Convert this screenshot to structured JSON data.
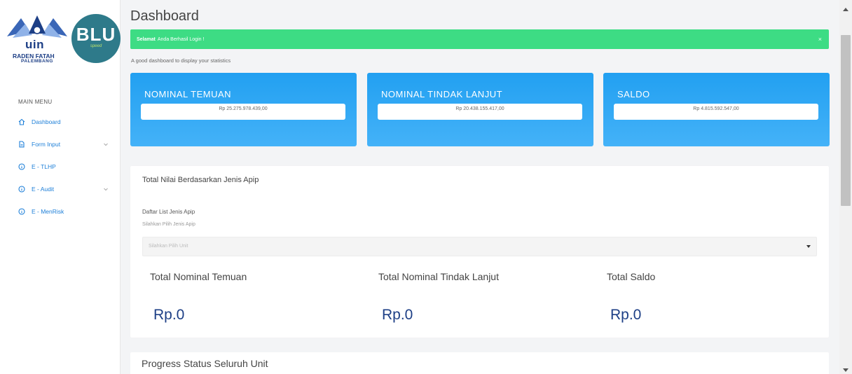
{
  "branding": {
    "uin_logo_text": "uin",
    "uin_name": "RADEN FATAH",
    "uin_city": "PALEMBANG",
    "blu_logo_text": "BLU",
    "blu_tagline": "speed"
  },
  "sidebar": {
    "section_label": "MAIN MENU",
    "items": [
      {
        "label": "Dashboard",
        "icon": "home-icon"
      },
      {
        "label": "Form Input",
        "icon": "document-icon",
        "has_submenu": true
      },
      {
        "label": "E - TLHP",
        "icon": "info-circle-icon"
      },
      {
        "label": "E - Audit",
        "icon": "info-circle-icon",
        "has_submenu": true
      },
      {
        "label": "E - MenRisk",
        "icon": "info-circle-icon"
      }
    ],
    "accent_color": "#1d7fd8"
  },
  "header": {
    "title": "Dashboard"
  },
  "alert": {
    "strong": "Selamat",
    "message": "Anda Berhasil Login !",
    "close": "×",
    "color": "#3ddc84"
  },
  "subtitle": "A good dashboard to display your statistics",
  "stats": [
    {
      "label": "NOMINAL TEMUAN",
      "value": "Rp 25.275.978.439,00"
    },
    {
      "label": "NOMINAL TINDAK LANJUT",
      "value": "Rp 20.438.155.417,00"
    },
    {
      "label": "SALDO",
      "value": "Rp 4.815.592.547,00"
    }
  ],
  "apip_panel": {
    "title": "Total Nilai Berdasarkan Jenis Apip",
    "field_label": "Daftar List Jenis Apip",
    "field_help": "Silahkan Pilih Jenis Apip",
    "select_placeholder": "Silahkan Pilih Unit",
    "totals": [
      {
        "label": "Total Nominal Temuan",
        "value": "Rp.0"
      },
      {
        "label": "Total Nominal Tindak Lanjut",
        "value": "Rp.0"
      },
      {
        "label": "Total Saldo",
        "value": "Rp.0"
      }
    ]
  },
  "progress_panel": {
    "title": "Progress Status Seluruh Unit"
  }
}
